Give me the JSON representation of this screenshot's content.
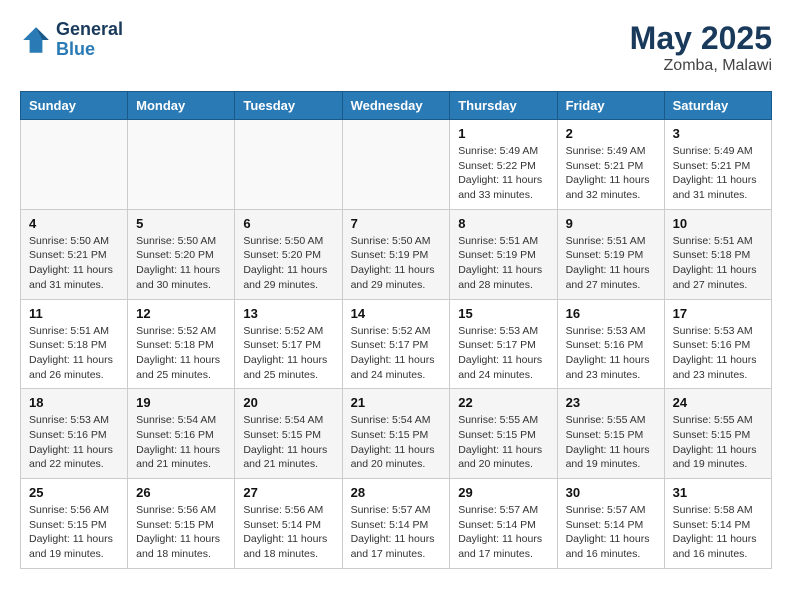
{
  "header": {
    "logo_line1": "General",
    "logo_line2": "Blue",
    "title": "May 2025",
    "subtitle": "Zomba, Malawi"
  },
  "weekdays": [
    "Sunday",
    "Monday",
    "Tuesday",
    "Wednesday",
    "Thursday",
    "Friday",
    "Saturday"
  ],
  "weeks": [
    [
      {
        "day": "",
        "info": ""
      },
      {
        "day": "",
        "info": ""
      },
      {
        "day": "",
        "info": ""
      },
      {
        "day": "",
        "info": ""
      },
      {
        "day": "1",
        "info": "Sunrise: 5:49 AM\nSunset: 5:22 PM\nDaylight: 11 hours\nand 33 minutes."
      },
      {
        "day": "2",
        "info": "Sunrise: 5:49 AM\nSunset: 5:21 PM\nDaylight: 11 hours\nand 32 minutes."
      },
      {
        "day": "3",
        "info": "Sunrise: 5:49 AM\nSunset: 5:21 PM\nDaylight: 11 hours\nand 31 minutes."
      }
    ],
    [
      {
        "day": "4",
        "info": "Sunrise: 5:50 AM\nSunset: 5:21 PM\nDaylight: 11 hours\nand 31 minutes."
      },
      {
        "day": "5",
        "info": "Sunrise: 5:50 AM\nSunset: 5:20 PM\nDaylight: 11 hours\nand 30 minutes."
      },
      {
        "day": "6",
        "info": "Sunrise: 5:50 AM\nSunset: 5:20 PM\nDaylight: 11 hours\nand 29 minutes."
      },
      {
        "day": "7",
        "info": "Sunrise: 5:50 AM\nSunset: 5:19 PM\nDaylight: 11 hours\nand 29 minutes."
      },
      {
        "day": "8",
        "info": "Sunrise: 5:51 AM\nSunset: 5:19 PM\nDaylight: 11 hours\nand 28 minutes."
      },
      {
        "day": "9",
        "info": "Sunrise: 5:51 AM\nSunset: 5:19 PM\nDaylight: 11 hours\nand 27 minutes."
      },
      {
        "day": "10",
        "info": "Sunrise: 5:51 AM\nSunset: 5:18 PM\nDaylight: 11 hours\nand 27 minutes."
      }
    ],
    [
      {
        "day": "11",
        "info": "Sunrise: 5:51 AM\nSunset: 5:18 PM\nDaylight: 11 hours\nand 26 minutes."
      },
      {
        "day": "12",
        "info": "Sunrise: 5:52 AM\nSunset: 5:18 PM\nDaylight: 11 hours\nand 25 minutes."
      },
      {
        "day": "13",
        "info": "Sunrise: 5:52 AM\nSunset: 5:17 PM\nDaylight: 11 hours\nand 25 minutes."
      },
      {
        "day": "14",
        "info": "Sunrise: 5:52 AM\nSunset: 5:17 PM\nDaylight: 11 hours\nand 24 minutes."
      },
      {
        "day": "15",
        "info": "Sunrise: 5:53 AM\nSunset: 5:17 PM\nDaylight: 11 hours\nand 24 minutes."
      },
      {
        "day": "16",
        "info": "Sunrise: 5:53 AM\nSunset: 5:16 PM\nDaylight: 11 hours\nand 23 minutes."
      },
      {
        "day": "17",
        "info": "Sunrise: 5:53 AM\nSunset: 5:16 PM\nDaylight: 11 hours\nand 23 minutes."
      }
    ],
    [
      {
        "day": "18",
        "info": "Sunrise: 5:53 AM\nSunset: 5:16 PM\nDaylight: 11 hours\nand 22 minutes."
      },
      {
        "day": "19",
        "info": "Sunrise: 5:54 AM\nSunset: 5:16 PM\nDaylight: 11 hours\nand 21 minutes."
      },
      {
        "day": "20",
        "info": "Sunrise: 5:54 AM\nSunset: 5:15 PM\nDaylight: 11 hours\nand 21 minutes."
      },
      {
        "day": "21",
        "info": "Sunrise: 5:54 AM\nSunset: 5:15 PM\nDaylight: 11 hours\nand 20 minutes."
      },
      {
        "day": "22",
        "info": "Sunrise: 5:55 AM\nSunset: 5:15 PM\nDaylight: 11 hours\nand 20 minutes."
      },
      {
        "day": "23",
        "info": "Sunrise: 5:55 AM\nSunset: 5:15 PM\nDaylight: 11 hours\nand 19 minutes."
      },
      {
        "day": "24",
        "info": "Sunrise: 5:55 AM\nSunset: 5:15 PM\nDaylight: 11 hours\nand 19 minutes."
      }
    ],
    [
      {
        "day": "25",
        "info": "Sunrise: 5:56 AM\nSunset: 5:15 PM\nDaylight: 11 hours\nand 19 minutes."
      },
      {
        "day": "26",
        "info": "Sunrise: 5:56 AM\nSunset: 5:15 PM\nDaylight: 11 hours\nand 18 minutes."
      },
      {
        "day": "27",
        "info": "Sunrise: 5:56 AM\nSunset: 5:14 PM\nDaylight: 11 hours\nand 18 minutes."
      },
      {
        "day": "28",
        "info": "Sunrise: 5:57 AM\nSunset: 5:14 PM\nDaylight: 11 hours\nand 17 minutes."
      },
      {
        "day": "29",
        "info": "Sunrise: 5:57 AM\nSunset: 5:14 PM\nDaylight: 11 hours\nand 17 minutes."
      },
      {
        "day": "30",
        "info": "Sunrise: 5:57 AM\nSunset: 5:14 PM\nDaylight: 11 hours\nand 16 minutes."
      },
      {
        "day": "31",
        "info": "Sunrise: 5:58 AM\nSunset: 5:14 PM\nDaylight: 11 hours\nand 16 minutes."
      }
    ]
  ]
}
